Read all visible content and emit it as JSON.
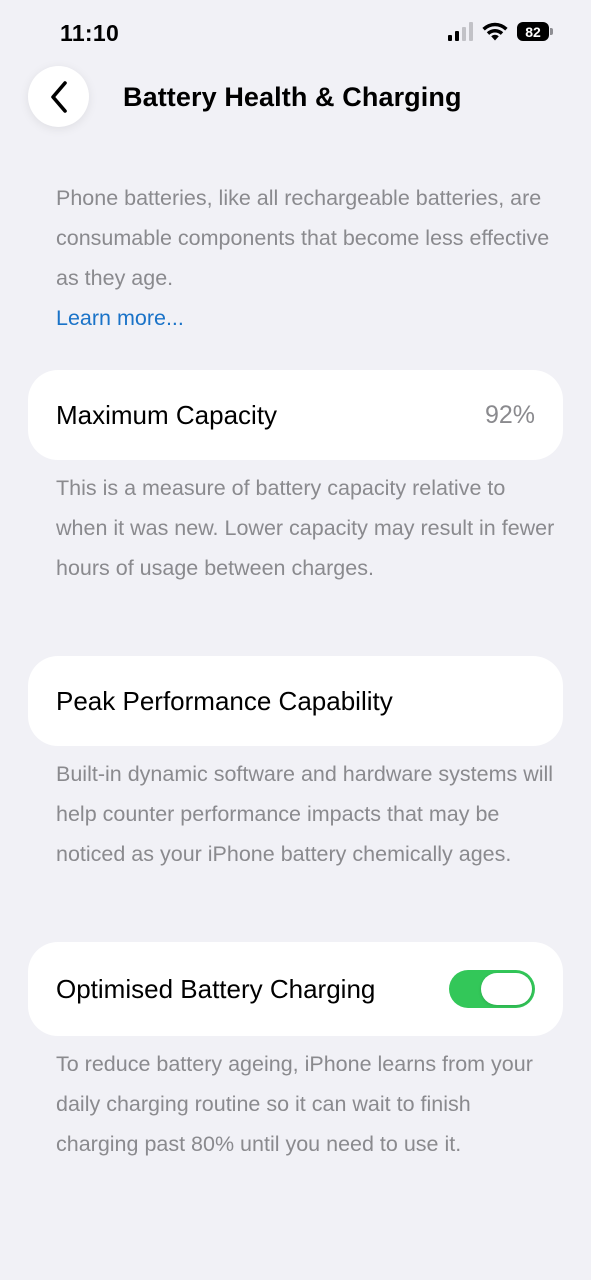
{
  "status_bar": {
    "time": "11:10",
    "battery_level": "82",
    "icons": [
      "cellular-signal-icon",
      "wifi-icon",
      "battery-icon"
    ]
  },
  "header": {
    "back_icon": "chevron-left-icon",
    "title": "Battery Health & Charging"
  },
  "intro": {
    "text": "Phone batteries, like all rechargeable batteries, are consumable components that become less effective as they age.",
    "link_label": "Learn more..."
  },
  "maximum_capacity": {
    "label": "Maximum Capacity",
    "value": "92%",
    "footnote": "This is a measure of battery capacity relative to when it was new. Lower capacity may result in fewer hours of usage between charges."
  },
  "peak_performance": {
    "label": "Peak Performance Capability",
    "footnote": "Built-in dynamic software and hardware systems will help counter performance impacts that may be noticed as your iPhone battery chemically ages."
  },
  "optimised_charging": {
    "label": "Optimised Battery Charging",
    "enabled": true,
    "toggle_color": "#33c759",
    "footnote": "To reduce battery ageing, iPhone learns from your daily charging routine so it can wait to finish charging past 80% until you need to use it."
  },
  "colors": {
    "background": "#f1f1f6",
    "card": "#ffffff",
    "secondary_text": "#8a8a8e",
    "link": "#1a73c8"
  }
}
